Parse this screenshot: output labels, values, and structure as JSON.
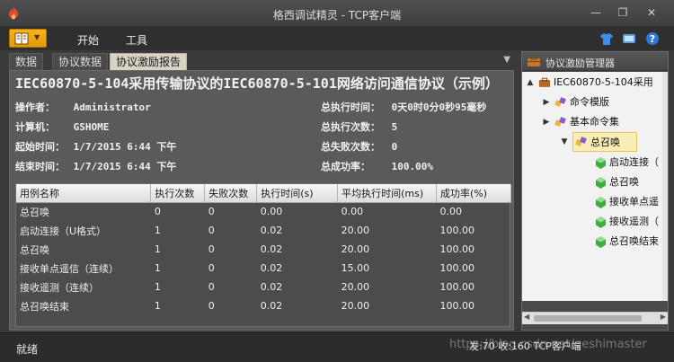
{
  "window": {
    "title": "格西调试精灵 - TCP客户端",
    "icon": "flame-icon"
  },
  "menu": {
    "file_icon": "book-icon",
    "items": [
      "开始",
      "工具"
    ],
    "tools": [
      "shirt-icon",
      "skin-icon",
      "help-icon"
    ]
  },
  "tabs": [
    "数据",
    "协议数据",
    "协议激励报告"
  ],
  "active_tab": 2,
  "report": {
    "title": "IEC60870-5-104采用传输协议的IEC60870-5-101网络访问通信协议（示例）",
    "operator_label": "操作者：",
    "operator": "Administrator",
    "computer_label": "计算机：",
    "computer": "GSHOME",
    "start_label": "起始时间：",
    "start": "1/7/2015 6:44 下午",
    "end_label": "结束时间：",
    "end": "1/7/2015 6:44 下午",
    "total_time_label": "总执行时间：",
    "total_time": "0天0时0分0秒95毫秒",
    "total_runs_label": "总执行次数：",
    "total_runs": "5",
    "total_fail_label": "总失败次数：",
    "total_fail": "0",
    "success_rate_label": "总成功率：",
    "success_rate": "100.00%"
  },
  "table": {
    "columns": [
      "用例名称",
      "执行次数",
      "失败次数",
      "执行时间(s)",
      "平均执行时间(ms)",
      "成功率(%)"
    ],
    "rows": [
      [
        "总召唤",
        "0",
        "0",
        "0.00",
        "0.00",
        "0.00"
      ],
      [
        "启动连接（U格式）",
        "1",
        "0",
        "0.02",
        "20.00",
        "100.00"
      ],
      [
        "总召唤",
        "1",
        "0",
        "0.02",
        "20.00",
        "100.00"
      ],
      [
        "接收单点遥信（连续）",
        "1",
        "0",
        "0.02",
        "15.00",
        "100.00"
      ],
      [
        "接收遥测（连续）",
        "1",
        "0",
        "0.02",
        "20.00",
        "100.00"
      ],
      [
        "总召唤结束",
        "1",
        "0",
        "0.02",
        "20.00",
        "100.00"
      ]
    ]
  },
  "manager": {
    "title": "协议激励管理器",
    "tree": [
      {
        "label": "IEC60870-5-104采用",
        "level": 0,
        "toggle": "▲",
        "icon": "briefcase-icon"
      },
      {
        "label": "命令模版",
        "level": 1,
        "toggle": "▶",
        "icon": "command-icon"
      },
      {
        "label": "基本命令集",
        "level": 1,
        "toggle": "▶",
        "icon": "command-icon"
      },
      {
        "label": "总召唤",
        "level": 2,
        "toggle": "▼",
        "icon": "command-icon",
        "selected": true
      },
      {
        "label": "启动连接（",
        "level": 3,
        "icon": "green-gem-icon"
      },
      {
        "label": "总召唤",
        "level": 3,
        "icon": "green-gem-icon"
      },
      {
        "label": "接收单点遥",
        "level": 3,
        "icon": "green-gem-icon"
      },
      {
        "label": "接收遥测（",
        "level": 3,
        "icon": "green-gem-icon"
      },
      {
        "label": "总召唤结束",
        "level": 3,
        "icon": "green-gem-icon"
      }
    ]
  },
  "status": {
    "left": "就绪",
    "right": "发:70 收:160 TCP客户端",
    "watermark": "https://blog.csdn.net/geshimaster"
  }
}
